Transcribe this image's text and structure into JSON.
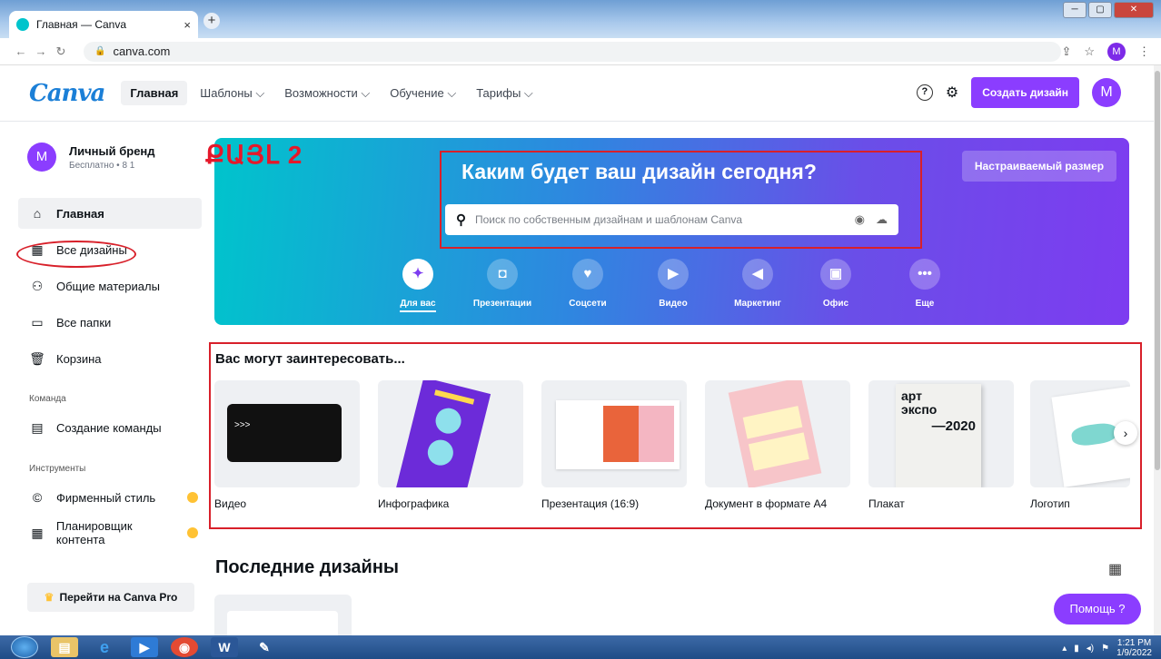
{
  "browser": {
    "tab_title": "Главная — Canva",
    "tab_close": "×",
    "new_tab": "+",
    "url": "canva.com",
    "window_controls": [
      "─",
      "▢",
      "✕"
    ],
    "profile_initial": "M"
  },
  "header": {
    "logo": "Canva",
    "nav": [
      {
        "label": "Главная",
        "active": true
      },
      {
        "label": "Шаблоны ⌵"
      },
      {
        "label": "Возможности ⌵"
      },
      {
        "label": "Обучение ⌵"
      },
      {
        "label": "Тарифы ⌵"
      }
    ],
    "help_icon": "?",
    "create_button": "Создать дизайн",
    "avatar_initial": "M"
  },
  "sidebar": {
    "brand_initial": "M",
    "brand_name": "Личный бренд",
    "brand_plan": "Бесплатно • 8 1",
    "items": [
      {
        "label": "Главная",
        "icon": "home-icon",
        "glyph": "⌂"
      },
      {
        "label": "Все дизайны",
        "icon": "grid-icon",
        "glyph": "▦"
      },
      {
        "label": "Общие материалы",
        "icon": "people-icon",
        "glyph": "⚇"
      },
      {
        "label": "Все папки",
        "icon": "folder-icon",
        "glyph": "▭"
      },
      {
        "label": "Корзина",
        "icon": "trash-icon",
        "glyph": "🗑"
      }
    ],
    "team_heading": "Команда",
    "team_item": "Создание команды",
    "tools_heading": "Инструменты",
    "tools_items": [
      "Фирменный стиль",
      "Планировщик контента"
    ],
    "pro_button": "Перейти на Canva Pro"
  },
  "annotation": "ՔԱՅԼ 2",
  "hero": {
    "title": "Каким будет ваш дизайн сегодня?",
    "search_placeholder": "Поиск по собственным дизайнам и шаблонам Canva",
    "custom_size": "Настраиваемый размер",
    "categories": [
      {
        "label": "Для вас",
        "glyph": "✦",
        "active": true
      },
      {
        "label": "Презентации",
        "glyph": "◘"
      },
      {
        "label": "Соцсети",
        "glyph": "♥"
      },
      {
        "label": "Видео",
        "glyph": "▶"
      },
      {
        "label": "Маркетинг",
        "glyph": "◀"
      },
      {
        "label": "Офис",
        "glyph": "▣"
      },
      {
        "label": "Еще",
        "glyph": "•••"
      }
    ]
  },
  "suggestions": {
    "title": "Вас могут заинтересовать...",
    "cards": [
      "Видео",
      "Инфографика",
      "Презентация (16:9)",
      "Документ в формате А4",
      "Плакат",
      "Логотип"
    ],
    "poster_text": [
      "арт",
      "экспо",
      "—2020"
    ]
  },
  "recent": {
    "title": "Последние дизайны"
  },
  "help_button": "Помощь ?",
  "taskbar": {
    "time": "1:21 PM",
    "date": "1/9/2022"
  },
  "colors": {
    "accent": "#8b3dff",
    "annotation_red": "#d8202a"
  }
}
